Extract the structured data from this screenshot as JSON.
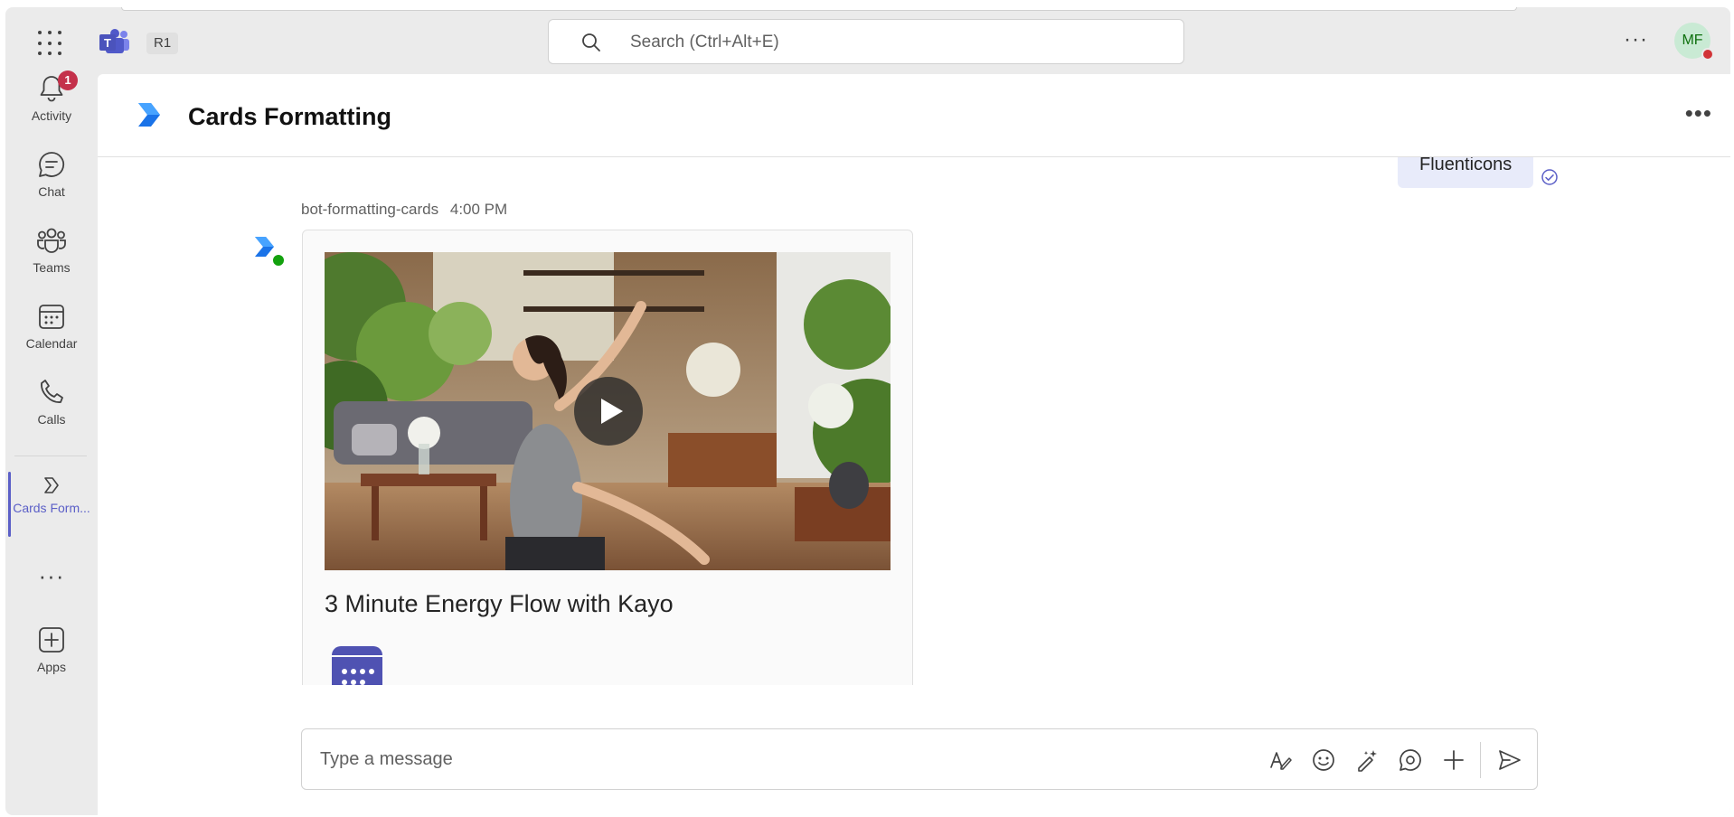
{
  "app": {
    "tenant_badge": "R1",
    "search_placeholder": "Search (Ctrl+Alt+E)",
    "user_initials": "MF"
  },
  "rail": {
    "items": [
      {
        "label": "Activity",
        "badge": "1"
      },
      {
        "label": "Chat"
      },
      {
        "label": "Teams"
      },
      {
        "label": "Calendar"
      },
      {
        "label": "Calls"
      },
      {
        "label": "Cards Form..."
      },
      {
        "label": "Apps"
      }
    ]
  },
  "chat": {
    "title": "Cards Formatting",
    "sent_message": "Fluenticons",
    "bot_name": "bot-formatting-cards",
    "message_time": "4:00 PM",
    "card_title": "3 Minute Energy Flow with Kayo"
  },
  "composer": {
    "placeholder": "Type a message"
  },
  "colors": {
    "brand": "#5b5fc7",
    "badge": "#c4314b",
    "presence_busy": "#d13438",
    "presence_available": "#13a10e"
  },
  "icons": [
    "waffle-icon",
    "teams-logo-icon",
    "search-icon",
    "more-icon",
    "bell-icon",
    "chat-icon",
    "teams-icon",
    "calendar-icon",
    "calls-icon",
    "cards-app-icon",
    "apps-add-icon",
    "format-icon",
    "emoji-icon",
    "copilot-icon",
    "loop-icon",
    "plus-icon",
    "send-icon",
    "play-icon",
    "read-receipt-icon"
  ]
}
